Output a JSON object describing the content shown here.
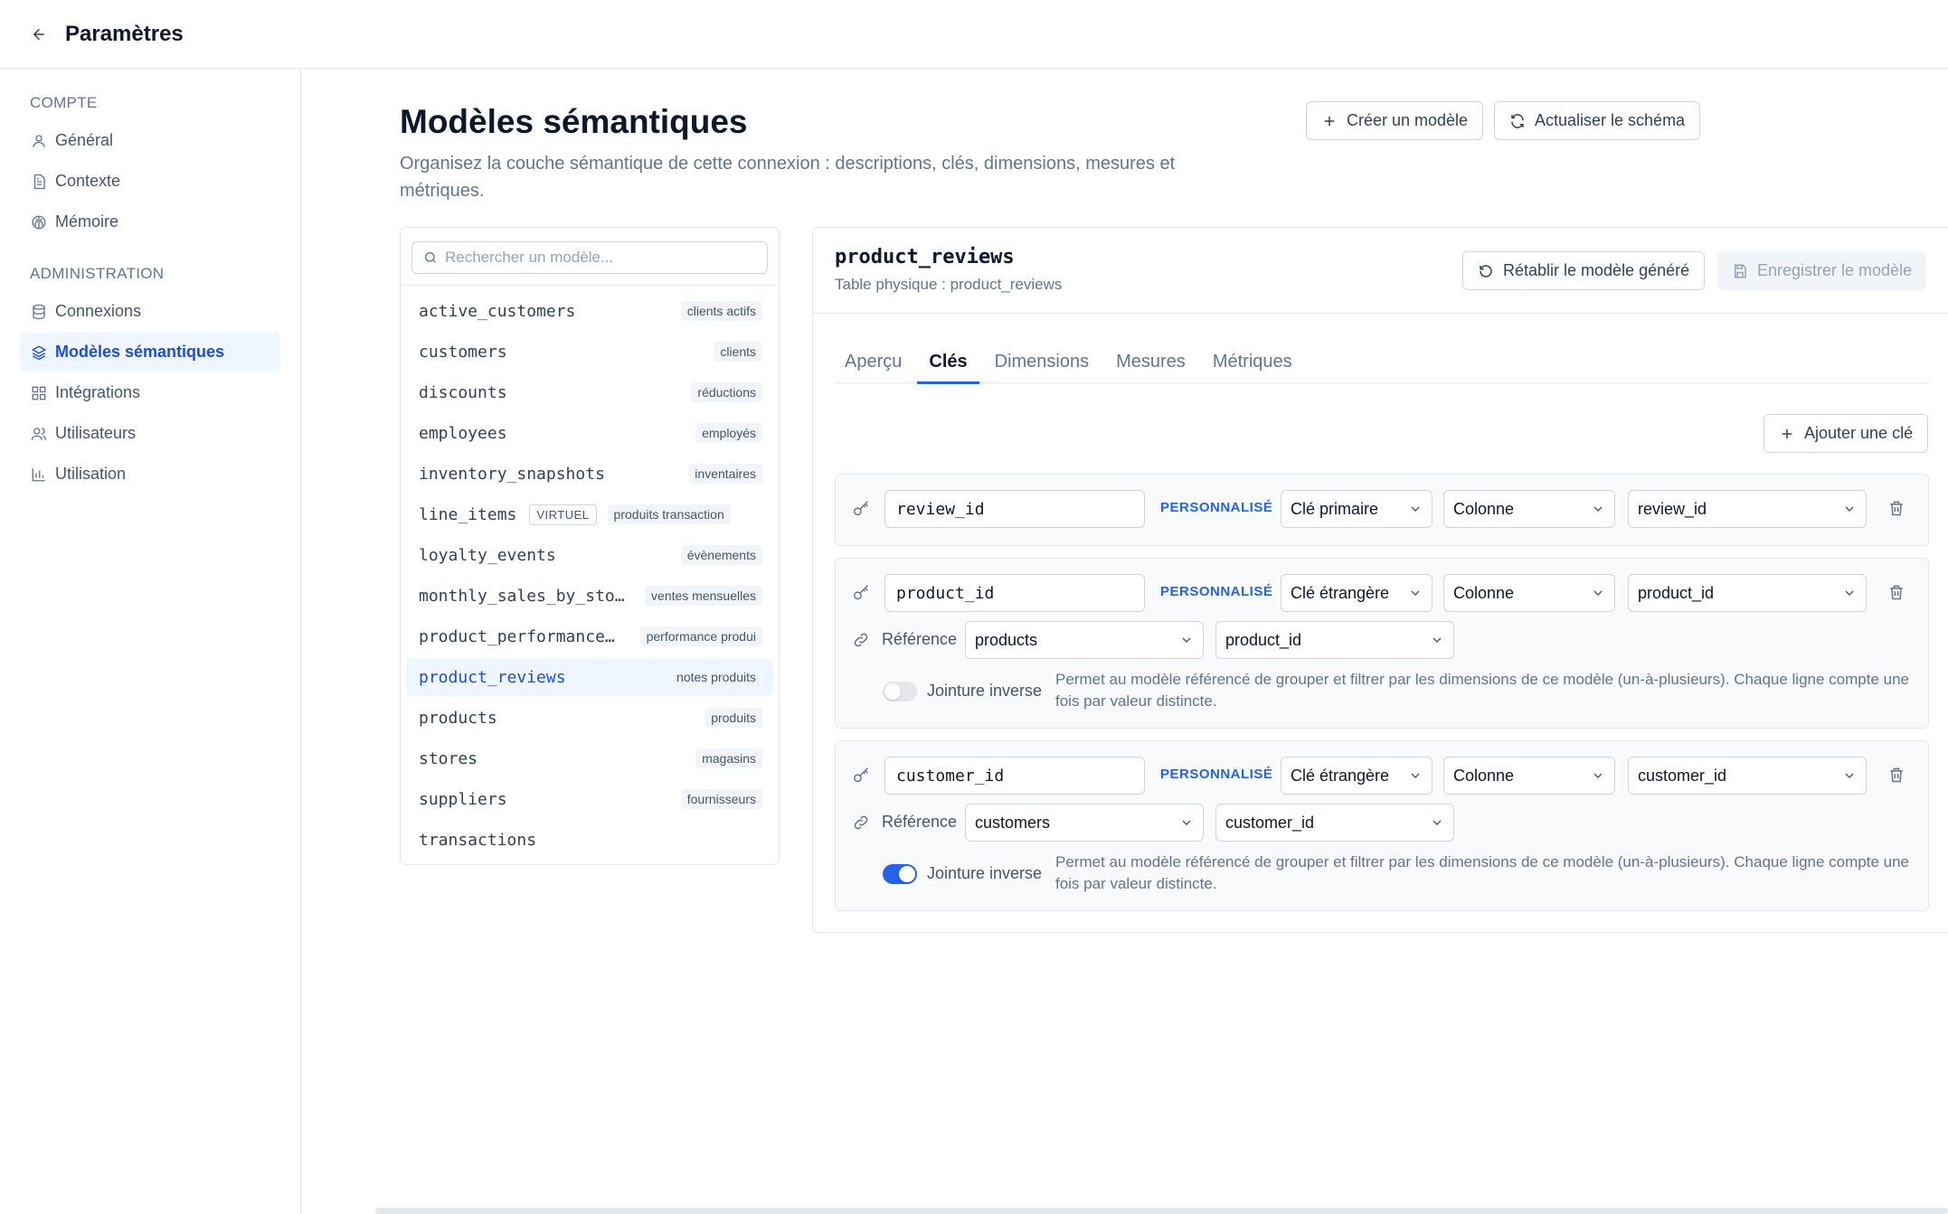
{
  "topbar": {
    "title": "Paramètres"
  },
  "sidebar": {
    "section_account": "COMPTE",
    "section_admin": "ADMINISTRATION",
    "items": [
      {
        "label": "Général",
        "icon": "user-icon"
      },
      {
        "label": "Contexte",
        "icon": "document-icon"
      },
      {
        "label": "Mémoire",
        "icon": "brain-icon"
      },
      {
        "label": "Connexions",
        "icon": "database-icon"
      },
      {
        "label": "Modèles sémantiques",
        "icon": "layers-icon",
        "active": true
      },
      {
        "label": "Intégrations",
        "icon": "puzzle-icon"
      },
      {
        "label": "Utilisateurs",
        "icon": "users-icon"
      },
      {
        "label": "Utilisation",
        "icon": "bar-chart-icon"
      }
    ]
  },
  "header": {
    "title": "Modèles sémantiques",
    "description": "Organisez la couche sémantique de cette connexion : descriptions, clés, dimensions, mesures et métriques.",
    "create_label": "Créer un modèle",
    "refresh_label": "Actualiser le schéma"
  },
  "models": {
    "search_placeholder": "Rechercher un modèle...",
    "items": [
      {
        "name": "active_customers",
        "tag": "clients actifs"
      },
      {
        "name": "customers",
        "tag": "clients"
      },
      {
        "name": "discounts",
        "tag": "réductions"
      },
      {
        "name": "employees",
        "tag": "employés"
      },
      {
        "name": "inventory_snapshots",
        "tag": "inventaires"
      },
      {
        "name": "line_items",
        "virtual": "VIRTUEL",
        "tag": "produits transaction"
      },
      {
        "name": "loyalty_events",
        "tag": "évènements"
      },
      {
        "name": "monthly_sales_by_sto…",
        "tag": "ventes mensuelles"
      },
      {
        "name": "product_performance…",
        "tag": "performance produi"
      },
      {
        "name": "product_reviews",
        "tag": "notes produits",
        "active": true
      },
      {
        "name": "products",
        "tag": "produits"
      },
      {
        "name": "stores",
        "tag": "magasins"
      },
      {
        "name": "suppliers",
        "tag": "fournisseurs"
      },
      {
        "name": "transactions",
        "tag": ""
      }
    ]
  },
  "detail": {
    "name": "product_reviews",
    "physical_table": "Table physique : product_reviews",
    "reset_label": "Rétablir le modèle généré",
    "save_label": "Enregistrer le modèle",
    "tabs": [
      "Aperçu",
      "Clés",
      "Dimensions",
      "Mesures",
      "Métriques"
    ],
    "active_tab": "Clés",
    "add_key_label": "Ajouter une clé",
    "keys": [
      {
        "name": "review_id",
        "badge": "PERSONNALISÉ",
        "key_type": "Clé primaire",
        "source_type": "Colonne",
        "column": "review_id"
      },
      {
        "name": "product_id",
        "badge": "PERSONNALISÉ",
        "key_type": "Clé étrangère",
        "source_type": "Colonne",
        "column": "product_id",
        "reference_label": "Référence",
        "ref_model": "products",
        "ref_column": "product_id",
        "inverse_label": "Jointure inverse",
        "inverse_on": false,
        "inverse_desc": "Permet au modèle référencé de grouper et filtrer par les dimensions de ce modèle (un-à-plusieurs). Chaque ligne compte une fois par valeur distincte."
      },
      {
        "name": "customer_id",
        "badge": "PERSONNALISÉ",
        "key_type": "Clé étrangère",
        "source_type": "Colonne",
        "column": "customer_id",
        "reference_label": "Référence",
        "ref_model": "customers",
        "ref_column": "customer_id",
        "inverse_label": "Jointure inverse",
        "inverse_on": true,
        "inverse_desc": "Permet au modèle référencé de grouper et filtrer par les dimensions de ce modèle (un-à-plusieurs). Chaque ligne compte une fois par valeur distincte."
      }
    ]
  },
  "colors": {
    "accent": "#2563eb",
    "accent_bg": "#eff6ff",
    "muted": "#64748b",
    "border": "#e5e7eb"
  }
}
